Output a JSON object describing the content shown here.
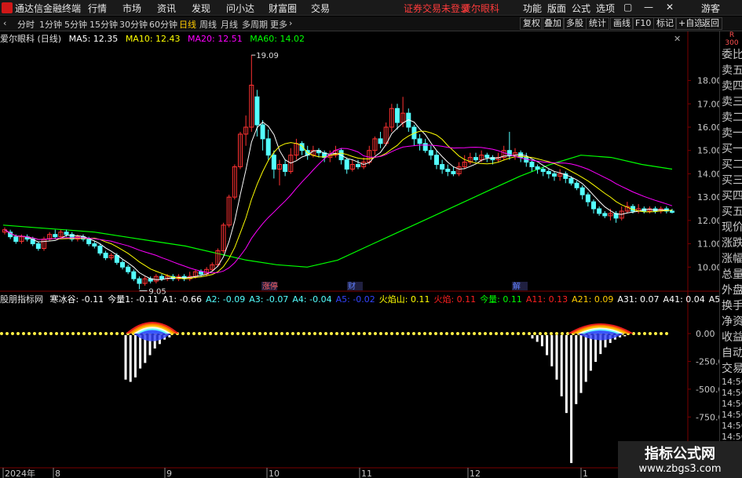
{
  "menu": {
    "app_title": "通达信金融终端",
    "items": [
      "行情",
      "市场",
      "资讯",
      "发现",
      "问小达",
      "财富圈",
      "交易"
    ],
    "notice": "证券交易未登录",
    "stock_tag": "爱尔眼科",
    "right_items": [
      "功能",
      "版面",
      "公式",
      "选项"
    ],
    "user": "游客"
  },
  "toolbar": {
    "periods": [
      "分时",
      "1分钟",
      "5分钟",
      "15分钟",
      "30分钟",
      "60分钟",
      "日线",
      "周线",
      "月线",
      "多周期",
      "更多"
    ],
    "active_period": "日线",
    "right_buttons": [
      "复权",
      "叠加",
      "多股",
      "统计",
      "画线",
      "F10",
      "标记",
      "+自选",
      "返回"
    ]
  },
  "legend": {
    "stock": "爱尔眼科 (日线)",
    "ma5": "MA5: 12.35",
    "ma10": "MA10: 12.43",
    "ma20": "MA20: 12.51",
    "ma60": "MA60: 14.02"
  },
  "colors": {
    "up": "#ff3232",
    "down": "#54ffff",
    "ma5": "#ffffff",
    "ma10": "#ffff00",
    "ma20": "#ff00ff",
    "ma60": "#00ff00",
    "grid": "#7a0000",
    "bg": "#000000"
  },
  "price_axis": {
    "ticks": [
      "18.00",
      "17.00",
      "16.00",
      "15.00",
      "14.00",
      "13.00",
      "12.00",
      "11.00",
      "10.00"
    ],
    "high_label": "19.09",
    "low_label": "9.05"
  },
  "events": [
    "涨停",
    "财",
    "解"
  ],
  "sub_legend": {
    "name": "股朋指标网",
    "items": [
      {
        "t": "寒冰谷: -0.11",
        "c": "#ffffff"
      },
      {
        "t": "今量1: -0.11",
        "c": "#ffffff"
      },
      {
        "t": "A1: -0.66",
        "c": "#ffffff"
      },
      {
        "t": "A2: -0.09",
        "c": "#54ffff"
      },
      {
        "t": "A3: -0.07",
        "c": "#54ffff"
      },
      {
        "t": "A4: -0.04",
        "c": "#54ffff"
      },
      {
        "t": "A5: -0.02",
        "c": "#3344ff"
      },
      {
        "t": "火焰山: 0.11",
        "c": "#ffff00"
      },
      {
        "t": "火焰: 0.11",
        "c": "#ff2020"
      },
      {
        "t": "今量: 0.11",
        "c": "#00ff00"
      },
      {
        "t": "A11: 0.13",
        "c": "#ff2020"
      },
      {
        "t": "A21: 0.09",
        "c": "#ffcc00"
      },
      {
        "t": "A31: 0.07",
        "c": "#ffffff"
      },
      {
        "t": "A41: 0.04",
        "c": "#ffffff"
      },
      {
        "t": "A51: 0.02",
        "c": "#ffffff"
      }
    ]
  },
  "sub_axis": {
    "ticks": [
      "0.00",
      "-250.0",
      "-500.0",
      "-750.0",
      "-1000"
    ]
  },
  "date_axis": [
    "2024年",
    "8",
    "9",
    "10",
    "11",
    "12",
    "1"
  ],
  "right_panel": {
    "top_label": "R\n300",
    "items": [
      "委比",
      "卖五",
      "卖四",
      "卖三",
      "卖二",
      "卖一",
      "买一",
      "买二",
      "买三",
      "买四",
      "买五",
      "现价",
      "涨跌",
      "涨幅",
      "总量",
      "外盘",
      "换手",
      "净资",
      "收益",
      "自动",
      "交易",
      "14:56",
      "14:56",
      "14:56",
      "14:56",
      "14:56",
      "14:56",
      "14:56",
      "14:56"
    ]
  },
  "watermark": {
    "line1": "指标公式网",
    "line2": "www.zbgs3.com"
  },
  "chart_data": {
    "type": "candlestick",
    "ylim": [
      9.0,
      19.5
    ],
    "candles": [
      [
        11.5,
        11.6,
        11.4,
        11.7
      ],
      [
        11.5,
        11.3,
        11.2,
        11.6
      ],
      [
        11.3,
        11.1,
        11.0,
        11.4
      ],
      [
        11.1,
        11.3,
        11.0,
        11.4
      ],
      [
        11.3,
        11.2,
        11.1,
        11.4
      ],
      [
        11.2,
        11.0,
        10.9,
        11.3
      ],
      [
        11.0,
        10.8,
        10.7,
        11.1
      ],
      [
        10.8,
        11.2,
        10.7,
        11.3
      ],
      [
        11.2,
        11.4,
        11.1,
        11.5
      ],
      [
        11.4,
        11.3,
        11.2,
        11.6
      ],
      [
        11.3,
        11.5,
        11.2,
        11.6
      ],
      [
        11.5,
        11.4,
        11.3,
        11.6
      ],
      [
        11.4,
        11.2,
        11.1,
        11.5
      ],
      [
        11.2,
        11.3,
        11.1,
        11.4
      ],
      [
        11.3,
        11.2,
        11.1,
        11.4
      ],
      [
        11.2,
        11.0,
        10.9,
        11.3
      ],
      [
        11.0,
        10.9,
        10.8,
        11.1
      ],
      [
        10.9,
        10.6,
        10.5,
        11.0
      ],
      [
        10.6,
        10.4,
        10.3,
        10.7
      ],
      [
        10.4,
        10.5,
        10.3,
        10.6
      ],
      [
        10.5,
        10.2,
        10.1,
        10.6
      ],
      [
        10.2,
        10.0,
        9.9,
        10.3
      ],
      [
        10.0,
        9.8,
        9.7,
        10.1
      ],
      [
        9.8,
        9.5,
        9.4,
        9.9
      ],
      [
        9.5,
        9.3,
        9.05,
        9.6
      ],
      [
        9.3,
        9.5,
        9.2,
        9.6
      ],
      [
        9.5,
        9.4,
        9.3,
        9.6
      ],
      [
        9.4,
        9.6,
        9.3,
        9.7
      ],
      [
        9.6,
        9.5,
        9.4,
        9.7
      ],
      [
        9.5,
        9.6,
        9.4,
        9.7
      ],
      [
        9.6,
        9.5,
        9.4,
        9.7
      ],
      [
        9.5,
        9.6,
        9.4,
        9.7
      ],
      [
        9.6,
        9.5,
        9.4,
        9.7
      ],
      [
        9.5,
        9.6,
        9.4,
        9.8
      ],
      [
        9.6,
        9.8,
        9.5,
        9.9
      ],
      [
        9.8,
        9.7,
        9.6,
        9.9
      ],
      [
        9.7,
        9.9,
        9.6,
        10.0
      ],
      [
        9.9,
        10.1,
        9.8,
        10.2
      ],
      [
        10.1,
        10.7,
        10.0,
        10.8
      ],
      [
        10.7,
        11.8,
        10.6,
        11.9
      ],
      [
        11.8,
        13.0,
        11.7,
        13.1
      ],
      [
        13.0,
        14.3,
        12.9,
        14.4
      ],
      [
        14.3,
        15.7,
        14.2,
        15.8
      ],
      [
        15.7,
        16.0,
        15.2,
        16.5
      ],
      [
        16.0,
        17.8,
        15.8,
        19.09
      ],
      [
        17.3,
        16.1,
        15.6,
        17.6
      ],
      [
        16.1,
        15.5,
        15.0,
        16.3
      ],
      [
        15.5,
        14.8,
        14.6,
        15.9
      ],
      [
        14.8,
        14.2,
        13.8,
        15.0
      ],
      [
        14.2,
        14.4,
        13.5,
        14.6
      ],
      [
        14.4,
        14.1,
        13.9,
        14.6
      ],
      [
        14.1,
        14.8,
        14.0,
        15.1
      ],
      [
        14.8,
        15.3,
        14.6,
        15.5
      ],
      [
        15.3,
        15.0,
        14.8,
        15.4
      ],
      [
        15.0,
        14.8,
        14.6,
        15.2
      ],
      [
        14.8,
        15.0,
        14.7,
        15.2
      ],
      [
        15.0,
        14.9,
        14.7,
        15.1
      ],
      [
        14.9,
        14.7,
        14.5,
        15.0
      ],
      [
        14.7,
        14.8,
        14.5,
        15.0
      ],
      [
        14.8,
        15.0,
        14.7,
        15.2
      ],
      [
        15.0,
        14.6,
        14.4,
        15.1
      ],
      [
        14.6,
        14.2,
        14.0,
        14.7
      ],
      [
        14.2,
        14.4,
        14.1,
        14.6
      ],
      [
        14.4,
        14.3,
        14.2,
        14.6
      ],
      [
        14.3,
        14.5,
        14.2,
        14.7
      ],
      [
        14.5,
        15.0,
        14.4,
        15.2
      ],
      [
        15.0,
        15.5,
        14.8,
        15.6
      ],
      [
        15.5,
        15.3,
        15.1,
        15.8
      ],
      [
        15.3,
        16.0,
        15.2,
        16.2
      ],
      [
        16.0,
        16.8,
        15.8,
        17.0
      ],
      [
        16.8,
        16.2,
        15.9,
        17.0
      ],
      [
        16.2,
        16.6,
        16.0,
        17.3
      ],
      [
        16.6,
        16.0,
        15.8,
        16.8
      ],
      [
        16.0,
        15.5,
        15.2,
        16.1
      ],
      [
        15.5,
        15.3,
        15.0,
        15.7
      ],
      [
        15.3,
        15.0,
        14.9,
        15.5
      ],
      [
        15.0,
        14.8,
        14.6,
        15.2
      ],
      [
        14.8,
        14.4,
        14.2,
        15.0
      ],
      [
        14.4,
        14.2,
        14.0,
        14.6
      ],
      [
        14.2,
        14.1,
        13.9,
        14.4
      ],
      [
        14.1,
        14.0,
        13.9,
        14.3
      ],
      [
        14.0,
        14.3,
        13.9,
        14.5
      ],
      [
        14.3,
        14.5,
        14.2,
        14.8
      ],
      [
        14.5,
        14.7,
        14.4,
        14.9
      ],
      [
        14.7,
        14.6,
        14.5,
        14.9
      ],
      [
        14.6,
        14.8,
        14.5,
        15.0
      ],
      [
        14.8,
        14.7,
        14.5,
        14.9
      ],
      [
        14.7,
        14.6,
        14.4,
        14.8
      ],
      [
        14.6,
        14.7,
        14.5,
        14.9
      ],
      [
        14.7,
        15.0,
        14.6,
        15.2
      ],
      [
        15.0,
        14.8,
        14.6,
        15.8
      ],
      [
        14.8,
        14.9,
        14.6,
        15.1
      ],
      [
        14.9,
        14.7,
        14.5,
        15.0
      ],
      [
        14.7,
        14.5,
        14.3,
        14.9
      ],
      [
        14.5,
        14.3,
        14.1,
        14.6
      ],
      [
        14.3,
        14.2,
        14.0,
        14.4
      ],
      [
        14.2,
        14.1,
        13.9,
        14.3
      ],
      [
        14.1,
        14.0,
        13.8,
        14.2
      ],
      [
        14.0,
        13.9,
        13.7,
        14.1
      ],
      [
        13.9,
        14.0,
        13.7,
        14.2
      ],
      [
        14.0,
        13.8,
        13.6,
        14.1
      ],
      [
        13.8,
        13.6,
        13.5,
        13.9
      ],
      [
        13.6,
        13.4,
        13.3,
        13.7
      ],
      [
        13.4,
        13.1,
        12.9,
        13.5
      ],
      [
        13.1,
        12.8,
        12.6,
        13.2
      ],
      [
        12.8,
        12.5,
        12.3,
        12.9
      ],
      [
        12.5,
        12.3,
        12.2,
        12.6
      ],
      [
        12.3,
        12.2,
        12.1,
        12.4
      ],
      [
        12.2,
        12.3,
        12.0,
        12.5
      ],
      [
        12.3,
        12.1,
        11.9,
        12.4
      ],
      [
        12.1,
        12.4,
        12.0,
        12.6
      ],
      [
        12.4,
        12.6,
        12.3,
        12.8
      ],
      [
        12.6,
        12.4,
        12.3,
        12.7
      ],
      [
        12.4,
        12.5,
        12.3,
        12.7
      ],
      [
        12.5,
        12.4,
        12.3,
        12.6
      ],
      [
        12.4,
        12.5,
        12.3,
        12.6
      ],
      [
        12.5,
        12.4,
        12.3,
        12.6
      ],
      [
        12.4,
        12.5,
        12.3,
        12.6
      ],
      [
        12.5,
        12.4,
        12.3,
        12.6
      ],
      [
        12.4,
        12.35,
        12.3,
        12.5
      ]
    ],
    "ma60": [
      11.8,
      11.7,
      11.6,
      11.5,
      11.3,
      11.1,
      10.9,
      10.6,
      10.3,
      10.1,
      10.0,
      10.3,
      10.9,
      11.5,
      12.1,
      12.7,
      13.3,
      13.9,
      14.4,
      14.8,
      14.7,
      14.4,
      14.2
    ],
    "sub_values": [
      -400,
      -420,
      -380,
      -300,
      -250,
      -180,
      -120,
      -80,
      -40,
      -20,
      0,
      0,
      0,
      0,
      0,
      0,
      0,
      0,
      0,
      0,
      0,
      0,
      0,
      0,
      0,
      0,
      -30,
      -60,
      -100,
      -180,
      -280,
      -400,
      -550,
      -700,
      -1150,
      -620,
      -520,
      -420,
      -320,
      -240,
      -170,
      -110,
      -70,
      -40,
      -20,
      -10
    ]
  }
}
